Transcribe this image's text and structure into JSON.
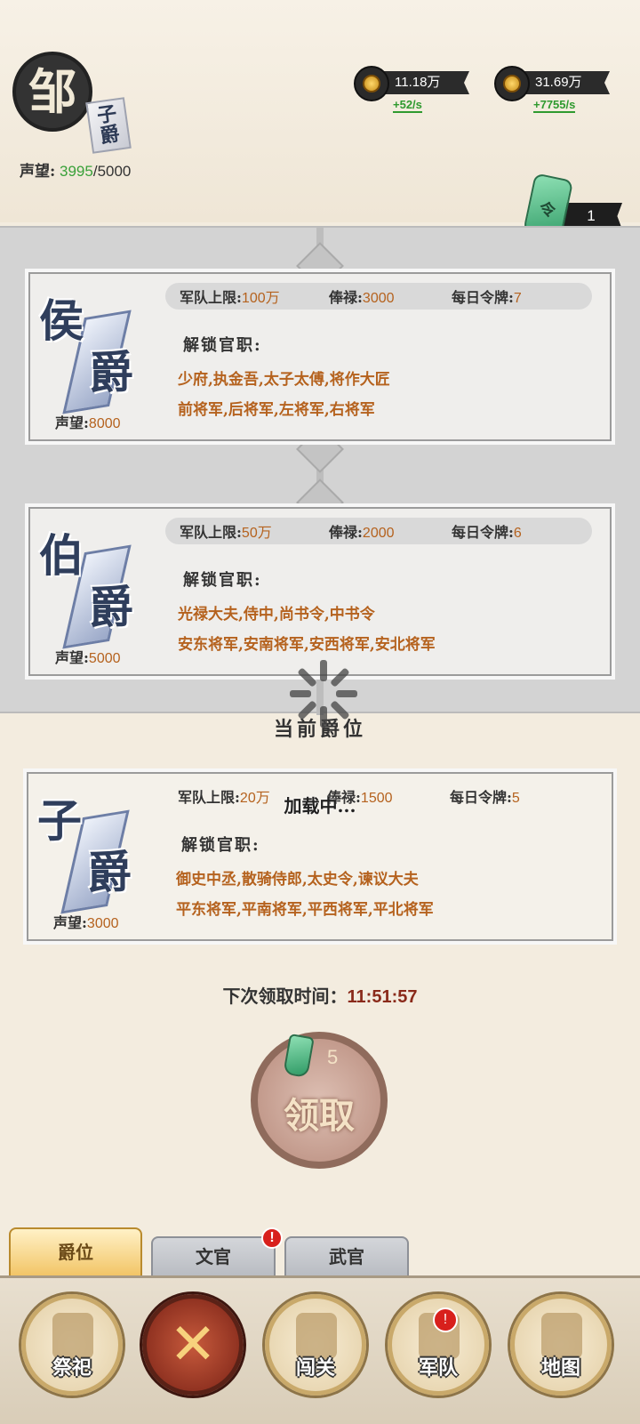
{
  "header": {
    "rank_char": "邹",
    "title_chars": [
      "子",
      "爵"
    ],
    "prestige_label": "声望:",
    "prestige_current": "3995",
    "prestige_max": "/5000",
    "resources": [
      {
        "name": "grain-icon",
        "value": "11.18万",
        "rate": "+52/s"
      },
      {
        "name": "coin-icon",
        "value": "31.69万",
        "rate": "+7755/s"
      }
    ],
    "token_char": "令",
    "token_count": "1"
  },
  "ranks": [
    {
      "char1": "侯",
      "char2": "爵",
      "stats": [
        {
          "label": "军队上限:",
          "value": "100万"
        },
        {
          "label": "俸禄:",
          "value": "3000"
        },
        {
          "label": "每日令牌:",
          "value": "7"
        }
      ],
      "unlock_title": "解锁官职:",
      "unlock_lines": [
        "少府,执金吾,太子太傅,将作大匠",
        "前将军,后将军,左将军,右将军"
      ],
      "prestige_label": "声望:",
      "prestige": "8000"
    },
    {
      "char1": "伯",
      "char2": "爵",
      "stats": [
        {
          "label": "军队上限:",
          "value": "50万"
        },
        {
          "label": "俸禄:",
          "value": "2000"
        },
        {
          "label": "每日令牌:",
          "value": "6"
        }
      ],
      "unlock_title": "解锁官职:",
      "unlock_lines": [
        "光禄大夫,侍中,尚书令,中书令",
        "安东将军,安南将军,安西将军,安北将军"
      ],
      "prestige_label": "声望:",
      "prestige": "5000"
    }
  ],
  "current_label": "当前爵位",
  "current_rank": {
    "char1": "子",
    "char2": "爵",
    "stats": [
      {
        "label": "军队上限:",
        "value": "20万"
      },
      {
        "label": "俸禄:",
        "value": "1500"
      },
      {
        "label": "每日令牌:",
        "value": "5"
      }
    ],
    "unlock_title": "解锁官职:",
    "unlock_lines": [
      "御史中丞,散骑侍郎,太史令,谏议大夫",
      "平东将军,平南将军,平西将军,平北将军"
    ],
    "prestige_label": "声望:",
    "prestige": "3000"
  },
  "loading_text": "加载中...",
  "timer": {
    "label": "下次领取时间：",
    "value": "11:51:57"
  },
  "claim": {
    "label": "领取",
    "count": "5"
  },
  "tabs": [
    {
      "label": "爵位",
      "active": true
    },
    {
      "label": "文官",
      "badge": "!"
    },
    {
      "label": "武官"
    }
  ],
  "nav": [
    {
      "label": "祭祀"
    },
    {
      "label": "✕"
    },
    {
      "label": "闯关"
    },
    {
      "label": "军队",
      "badge": "!"
    },
    {
      "label": "地图"
    }
  ]
}
